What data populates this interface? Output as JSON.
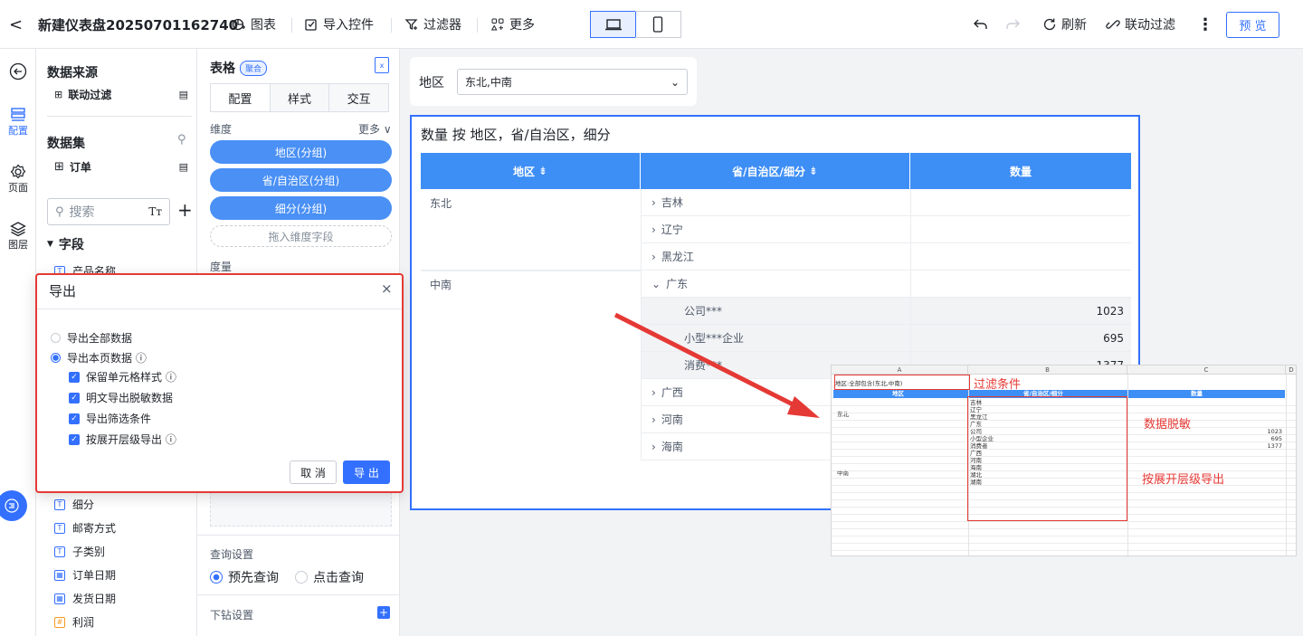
{
  "topbar": {
    "back": "<",
    "title": "新建仪表盘20250701162740",
    "chart": "图表",
    "import": "导入控件",
    "filter": "过滤器",
    "more": "更多",
    "refresh": "刷新",
    "linkage_filter": "联动过滤",
    "kebab": "⋮",
    "preview": "预 览"
  },
  "rail": {
    "config": "配置",
    "page": "页面",
    "layer": "图层"
  },
  "left": {
    "source_title": "数据来源",
    "linkage_filter": "联动过滤",
    "dataset_title": "数据集",
    "dataset_item": "订单",
    "search_placeholder": "搜索",
    "tt": "Tт",
    "plus": "+",
    "fields_title": "字段",
    "field_cut": "产品名称",
    "fields": [
      {
        "name": "细分",
        "icon": "T"
      },
      {
        "name": "邮寄方式",
        "icon": "T"
      },
      {
        "name": "子类别",
        "icon": "T"
      },
      {
        "name": "订单日期",
        "icon": "▦"
      },
      {
        "name": "发货日期",
        "icon": "▦"
      },
      {
        "name": "利润",
        "icon": "#"
      }
    ]
  },
  "mid": {
    "title": "表格",
    "badge": "聚合",
    "tabs": [
      "配置",
      "样式",
      "交互"
    ],
    "dimension_label": "维度",
    "more": "更多",
    "pills": [
      "地区(分组)",
      "省/自治区(分组)",
      "细分(分组)"
    ],
    "drop_hint": "拖入维度字段",
    "measure_label": "度量",
    "query_label": "查询设置",
    "query_options": [
      "预先查询",
      "点击查询"
    ],
    "drill_label": "下钻设置"
  },
  "canvas": {
    "filter_label": "地区",
    "filter_value": "东北,中南",
    "table_title": "数量 按 地区，省/自治区，细分",
    "headers": [
      "地区",
      "省/自治区/细分",
      "数量"
    ],
    "rows": [
      {
        "region": "东北",
        "prov": "吉林",
        "prefix": "›",
        "qty": "",
        "indent": false,
        "shade": false
      },
      {
        "region": "",
        "prov": "辽宁",
        "prefix": "›",
        "qty": "",
        "indent": false,
        "shade": false
      },
      {
        "region": "",
        "prov": "黑龙江",
        "prefix": "›",
        "qty": "",
        "indent": false,
        "shade": false
      },
      {
        "region": "中南",
        "prov": "广东",
        "prefix": "⌄",
        "qty": "",
        "indent": false,
        "shade": false
      },
      {
        "region": "",
        "prov": "公司***",
        "prefix": "",
        "qty": "1023",
        "indent": true,
        "shade": true
      },
      {
        "region": "",
        "prov": "小型***企业",
        "prefix": "",
        "qty": "695",
        "indent": true,
        "shade": true
      },
      {
        "region": "",
        "prov": "消费***",
        "prefix": "",
        "qty": "1377",
        "indent": true,
        "shade": true
      },
      {
        "region": "",
        "prov": "广西",
        "prefix": "›",
        "qty": "",
        "indent": false,
        "shade": false
      },
      {
        "region": "",
        "prov": "河南",
        "prefix": "›",
        "qty": "",
        "indent": false,
        "shade": false
      },
      {
        "region": "",
        "prov": "海南",
        "prefix": "›",
        "qty": "",
        "indent": false,
        "shade": false
      }
    ]
  },
  "dialog": {
    "title": "导出",
    "close": "×",
    "opt_all": "导出全部数据",
    "opt_page": "导出本页数据 ⓘ",
    "checks": [
      "保留单元格样式 ⓘ",
      "明文导出脱敏数据",
      "导出筛选条件",
      "按展开层级导出 ⓘ"
    ],
    "cancel": "取 消",
    "export": "导 出"
  },
  "excel": {
    "cols": [
      "A",
      "B",
      "C",
      "D"
    ],
    "filter_row": "地区:全部包含(东北,中南)",
    "headers": [
      "地区",
      "省/自治区/细分",
      "数量"
    ],
    "region_a": "东北",
    "region_b": "中南",
    "b_values": [
      "吉林",
      "辽宁",
      "黑龙江",
      "广东",
      "公司",
      "小型企业",
      "消费者",
      "广西",
      "河南",
      "海南",
      "湖北",
      "湖南"
    ],
    "c_values": [
      "",
      "",
      "",
      "",
      "1023",
      "695",
      "1377",
      "",
      "",
      "",
      "",
      ""
    ]
  },
  "annotations": {
    "filter": "过滤条件",
    "mask": "数据脱敏",
    "level": "按展开层级导出"
  },
  "colors": {
    "accent": "#3370ff",
    "header": "#3d8ef5",
    "alert": "#e53935"
  }
}
